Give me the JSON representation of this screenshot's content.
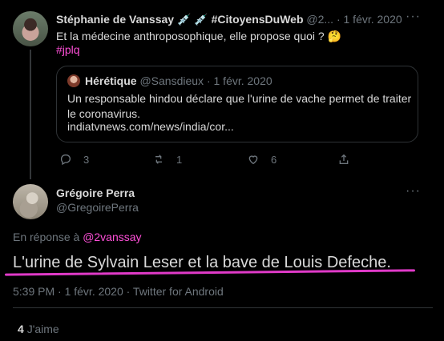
{
  "tweet1": {
    "author_name": "Stéphanie de Vanssay",
    "author_emoji": "💉 💉",
    "author_tag": "#CitoyensDuWeb",
    "handle": "@2...",
    "date": "· 1 févr. 2020",
    "text": "Et la médecine anthroposophique, elle propose quoi ? 🤔",
    "hashtag": "#jplq"
  },
  "quoted": {
    "author_name": "Hérétique",
    "handle": "@Sansdieux",
    "date": "· 1 févr. 2020",
    "text": "Un responsable hindou déclare que l'urine de vache permet de traiter le coronavirus.",
    "link": "indiatvnews.com/news/india/cor..."
  },
  "actions": {
    "replies": "3",
    "retweets": "1",
    "likes": "6"
  },
  "tweet2": {
    "author_name": "Grégoire Perra",
    "handle": "@GregoirePerra",
    "reply_prefix": "En réponse à",
    "reply_handle": "@2vanssay",
    "text": "L'urine de Sylvain Leser et la bave de Louis Defeche.",
    "meta": "5:39 PM · 1 févr. 2020 · Twitter for Android",
    "likes_count": "4",
    "likes_label": "J'aime"
  },
  "colors": {
    "background": "#000000",
    "link": "#ff4fd8",
    "highlight_line": "#e03ac8",
    "muted": "#6e767d"
  }
}
